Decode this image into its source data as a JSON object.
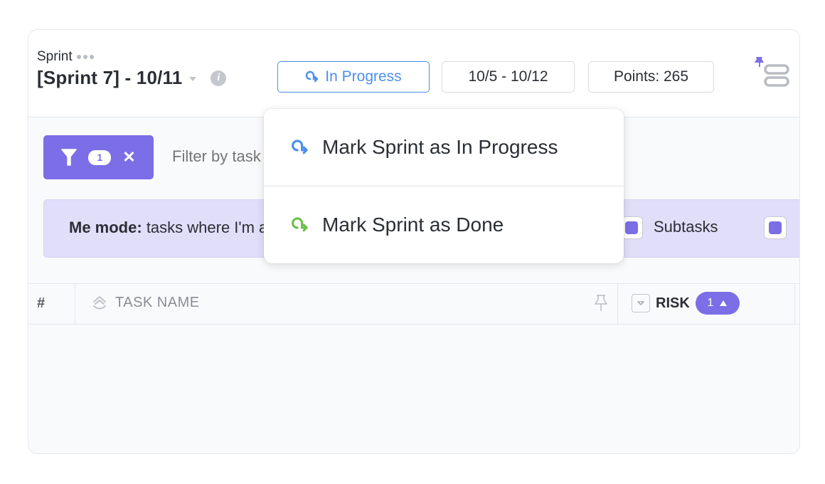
{
  "header": {
    "sprint_label": "Sprint",
    "sprint_title": "[Sprint 7] - 10/11",
    "status_button": "In Progress",
    "date_range": "10/5 - 10/12",
    "points": "Points: 265",
    "colors": {
      "status_blue": "#4a8ff0",
      "done_green": "#6cc04a",
      "accent_purple": "#7b6ee6"
    }
  },
  "filter": {
    "count": "1",
    "placeholder": "Filter by task name"
  },
  "me_mode": {
    "label": "Me mode:",
    "text": "tasks where I'm assigned",
    "subtasks_label": "Subtasks"
  },
  "table": {
    "columns": {
      "number": "#",
      "task_name": "TASK NAME",
      "risk": "RISK",
      "risk_sort_count": "1"
    }
  },
  "dropdown": {
    "items": [
      {
        "label": "Mark Sprint as In Progress",
        "icon": "in-progress-arrow-icon"
      },
      {
        "label": "Mark Sprint as Done",
        "icon": "done-arrow-icon"
      }
    ]
  }
}
